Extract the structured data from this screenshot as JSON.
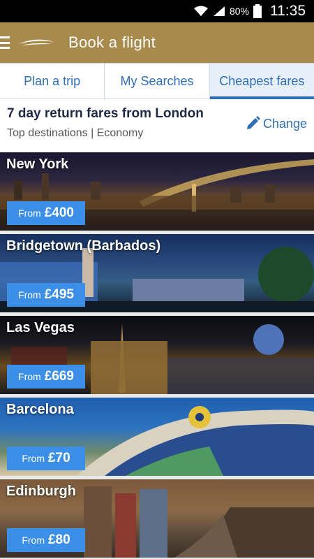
{
  "status_bar": {
    "battery_pct": "80%",
    "time": "11:35"
  },
  "app_bar": {
    "title": "Book a flight"
  },
  "tabs": [
    {
      "label": "Plan a trip",
      "active": false
    },
    {
      "label": "My Searches",
      "active": false
    },
    {
      "label": "Cheapest fares",
      "active": true
    }
  ],
  "info": {
    "title": "7 day return fares from London",
    "subtitle": "Top destinations | Economy",
    "change_label": "Change"
  },
  "destinations": [
    {
      "name": "New York",
      "from_label": "From",
      "price": "£400"
    },
    {
      "name": "Bridgetown (Barbados)",
      "from_label": "From",
      "price": "£495"
    },
    {
      "name": "Las Vegas",
      "from_label": "From",
      "price": "£669"
    },
    {
      "name": "Barcelona",
      "from_label": "From",
      "price": "£70"
    },
    {
      "name": "Edinburgh",
      "from_label": "From",
      "price": "£80"
    }
  ],
  "colors": {
    "brand_gold": "#a88b4c",
    "accent_blue": "#2f6fb6",
    "fare_badge_blue": "#3c8fe6"
  }
}
